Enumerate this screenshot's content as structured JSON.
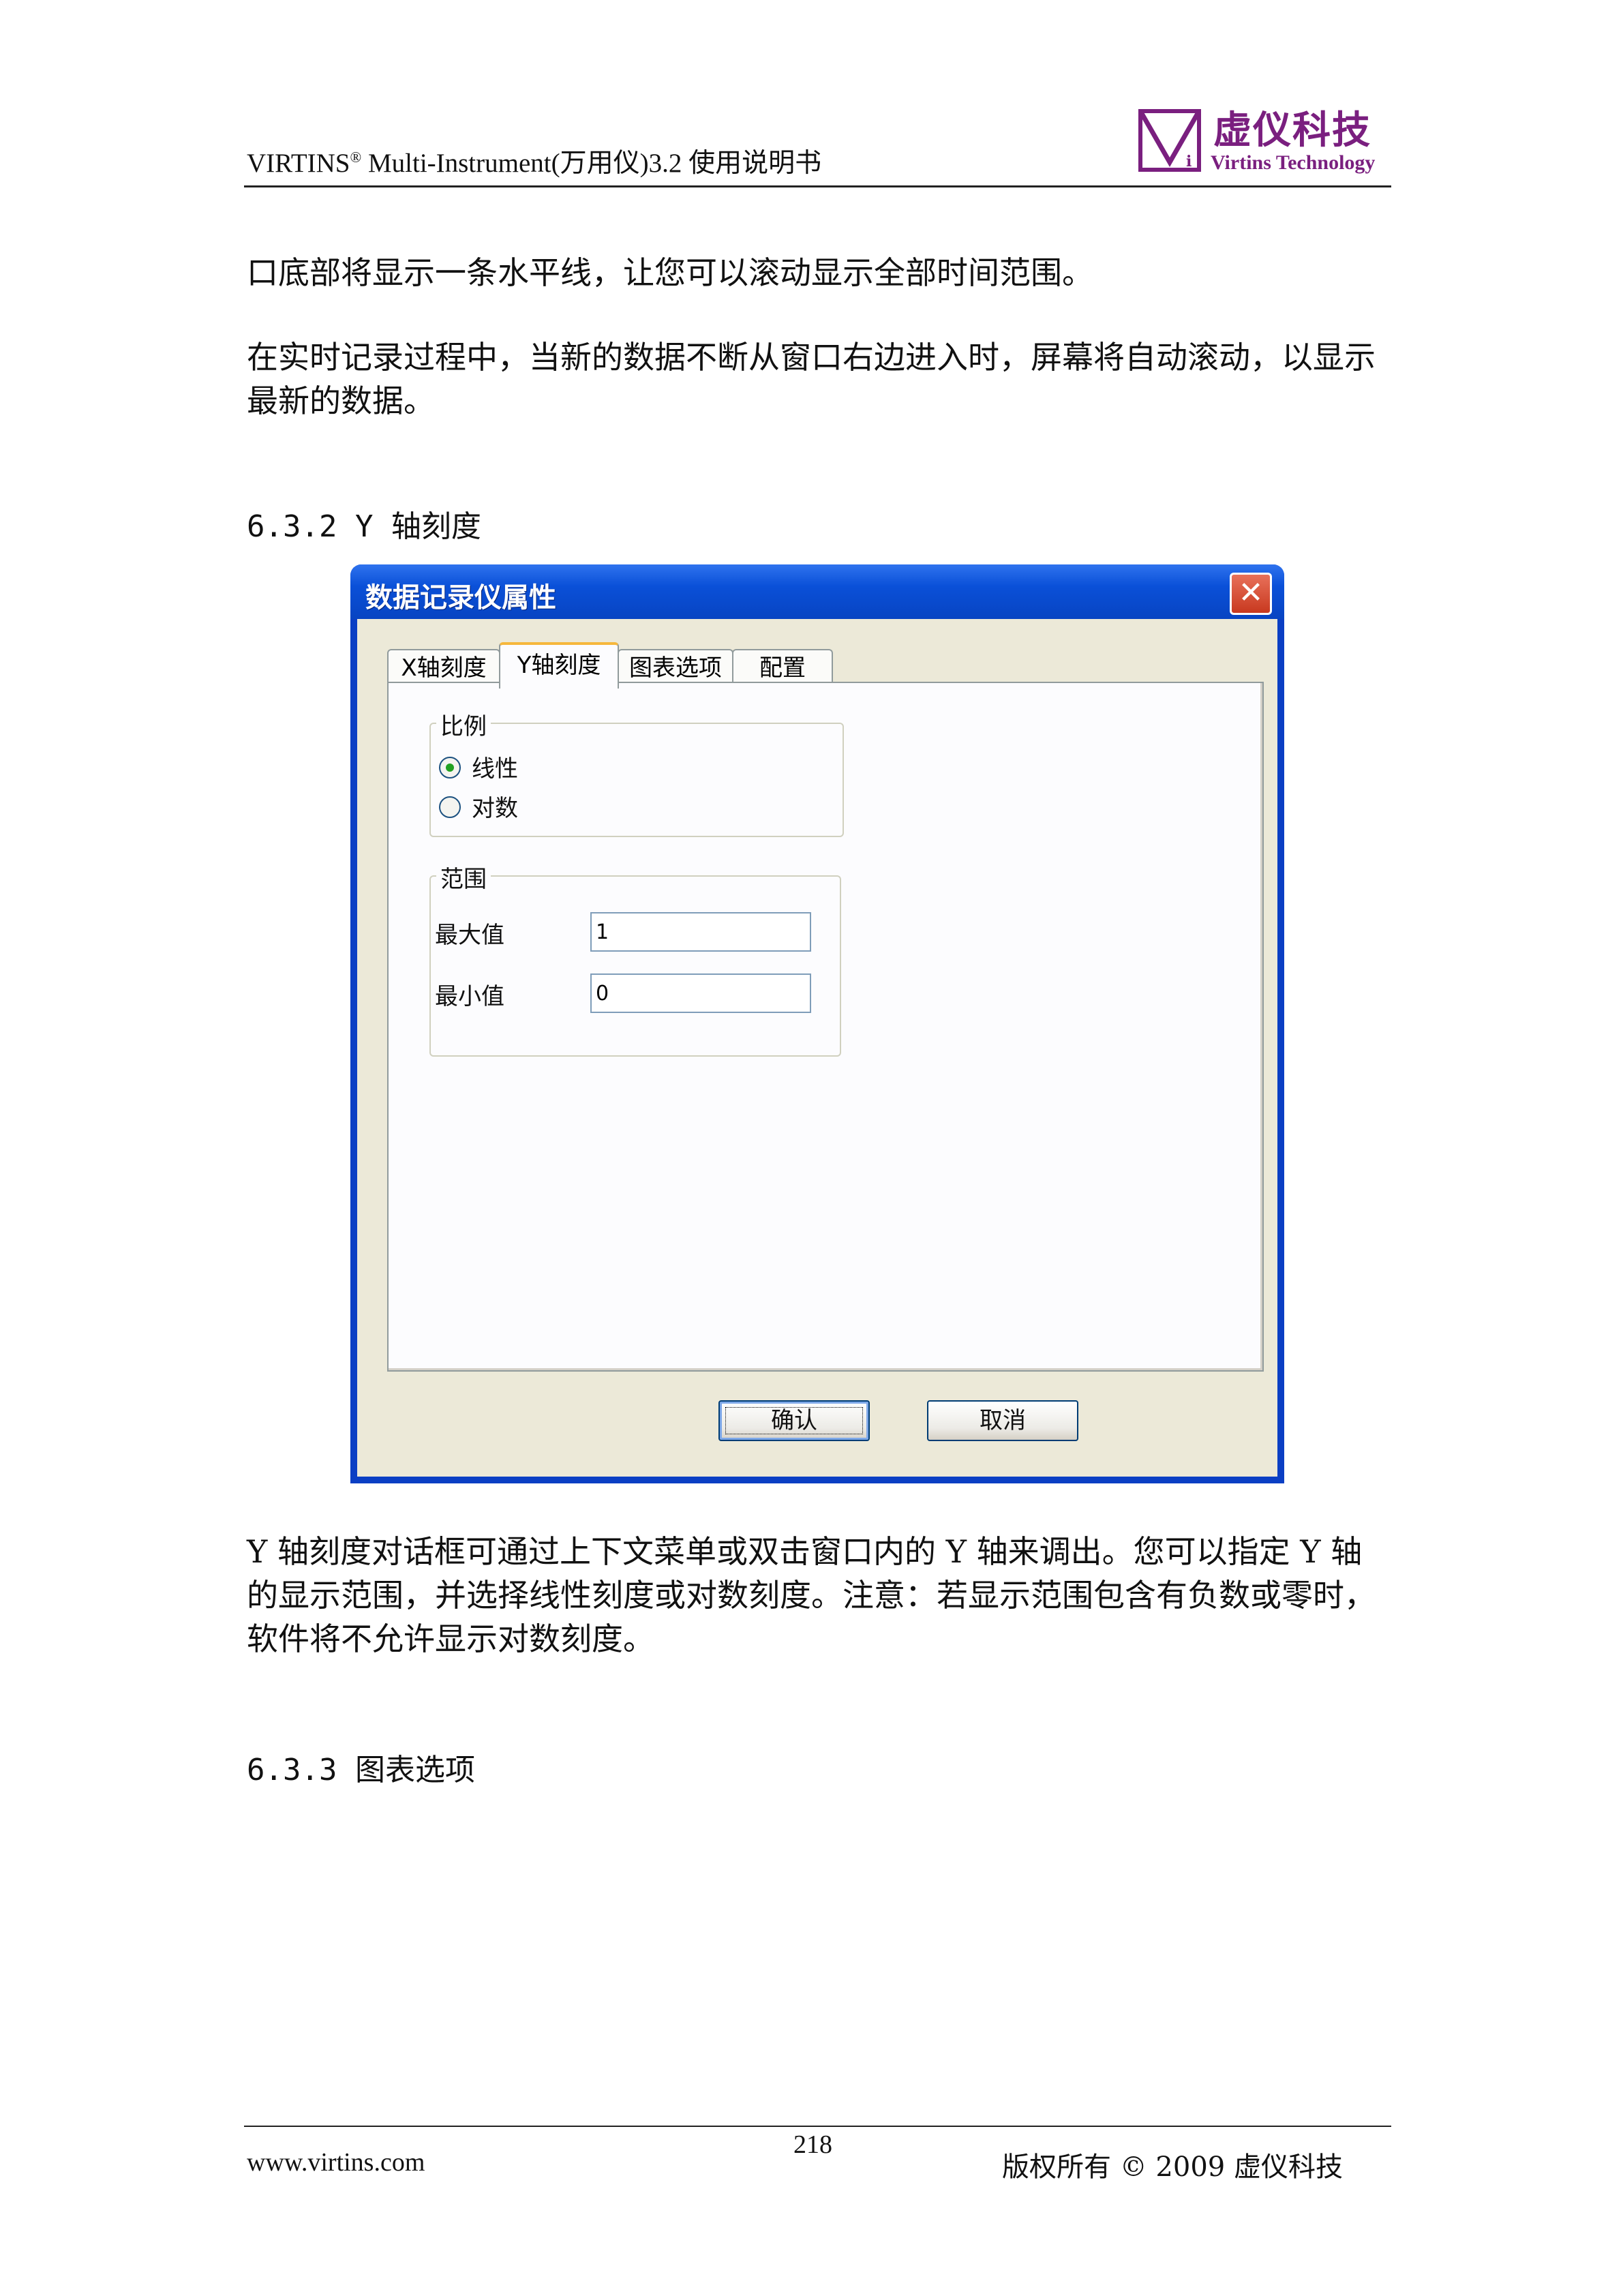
{
  "header": {
    "doc_title": "VIRTINS",
    "doc_title_sup": "®",
    "doc_title_rest": " Multi-Instrument(万用仪)3.2 使用说明书",
    "logo_cn": "虚仪科技",
    "logo_en": "Virtins Technology",
    "logo_color": "#7a1f7f"
  },
  "body": {
    "para1": "口底部将显示一条水平线，让您可以滚动显示全部时间范围。",
    "para2": "在实时记录过程中，当新的数据不断从窗口右边进入时，屏幕将自动滚动，以显示最新的数据。",
    "heading1": "6.3.2 Y 轴刻度",
    "para3": "Y 轴刻度对话框可通过上下文菜单或双击窗口内的 Y 轴来调出。您可以指定 Y 轴的显示范围，并选择线性刻度或对数刻度。注意：若显示范围包含有负数或零时，软件将不允许显示对数刻度。",
    "heading2": "6.3.3 图表选项"
  },
  "dialog": {
    "title": "数据记录仪属性",
    "close_icon": "close-x-icon",
    "tabs": [
      {
        "label": "X轴刻度",
        "active": false
      },
      {
        "label": "Y轴刻度",
        "active": true
      },
      {
        "label": "图表选项",
        "active": false
      },
      {
        "label": "配置",
        "active": false
      }
    ],
    "scale_group": {
      "label": "比例",
      "options": [
        {
          "label": "线性",
          "selected": true
        },
        {
          "label": "对数",
          "selected": false
        }
      ]
    },
    "range_group": {
      "label": "范围",
      "max_label": "最大值",
      "max_value": "1",
      "min_label": "最小值",
      "min_value": "0"
    },
    "ok_label": "确认",
    "cancel_label": "取消"
  },
  "footer": {
    "url": "www.virtins.com",
    "page_number": "218",
    "copyright": "版权所有 © 2009 虚仪科技"
  }
}
